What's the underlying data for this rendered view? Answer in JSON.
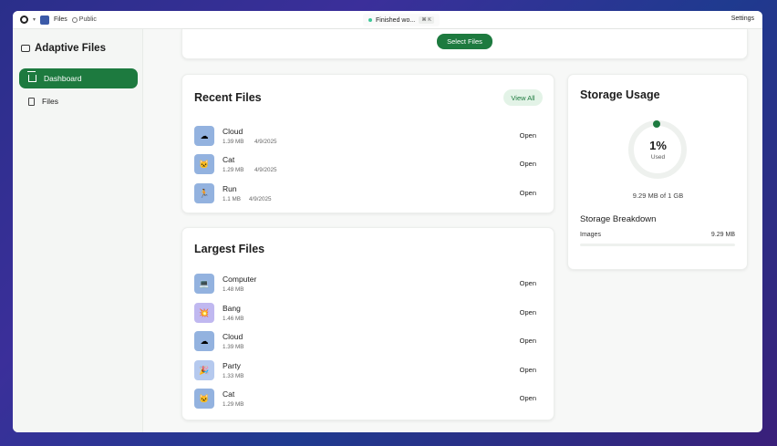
{
  "topbar": {
    "app_name": "Files",
    "visibility": "Public",
    "status_text": "Finished wo...",
    "shortcut": "⌘ K",
    "settings_label": "Settings"
  },
  "sidebar": {
    "brand": "Adaptive Files",
    "items": [
      {
        "label": "Dashboard",
        "icon": "home-icon",
        "active": true
      },
      {
        "label": "Files",
        "icon": "file-icon",
        "active": false
      }
    ]
  },
  "upload": {
    "select_label": "Select Files"
  },
  "recent": {
    "title": "Recent Files",
    "view_all": "View All",
    "files": [
      {
        "name": "Cloud",
        "size": "1.39 MB",
        "date": "4/9/2025",
        "icon": "cloud-icon",
        "action": "Open"
      },
      {
        "name": "Cat",
        "size": "1.29 MB",
        "date": "4/9/2025",
        "icon": "cat-icon",
        "action": "Open"
      },
      {
        "name": "Run",
        "size": "1.1 MB",
        "date": "4/9/2025",
        "icon": "runner-icon",
        "action": "Open"
      }
    ]
  },
  "largest": {
    "title": "Largest Files",
    "files": [
      {
        "name": "Computer",
        "size": "1.48 MB",
        "icon": "computer-icon",
        "action": "Open"
      },
      {
        "name": "Bang",
        "size": "1.46 MB",
        "icon": "bang-icon",
        "action": "Open"
      },
      {
        "name": "Cloud",
        "size": "1.39 MB",
        "icon": "cloud-icon",
        "action": "Open"
      },
      {
        "name": "Party",
        "size": "1.33 MB",
        "icon": "party-icon",
        "action": "Open"
      },
      {
        "name": "Cat",
        "size": "1.29 MB",
        "icon": "cat-icon",
        "action": "Open"
      }
    ]
  },
  "storage": {
    "title": "Storage Usage",
    "percent": "1%",
    "used_label": "Used",
    "total": "9.29 MB of 1 GB",
    "breakdown_title": "Storage Breakdown",
    "breakdown": [
      {
        "label": "Images",
        "value": "9.29 MB"
      }
    ]
  },
  "colors": {
    "accent": "#1d7a3f"
  }
}
